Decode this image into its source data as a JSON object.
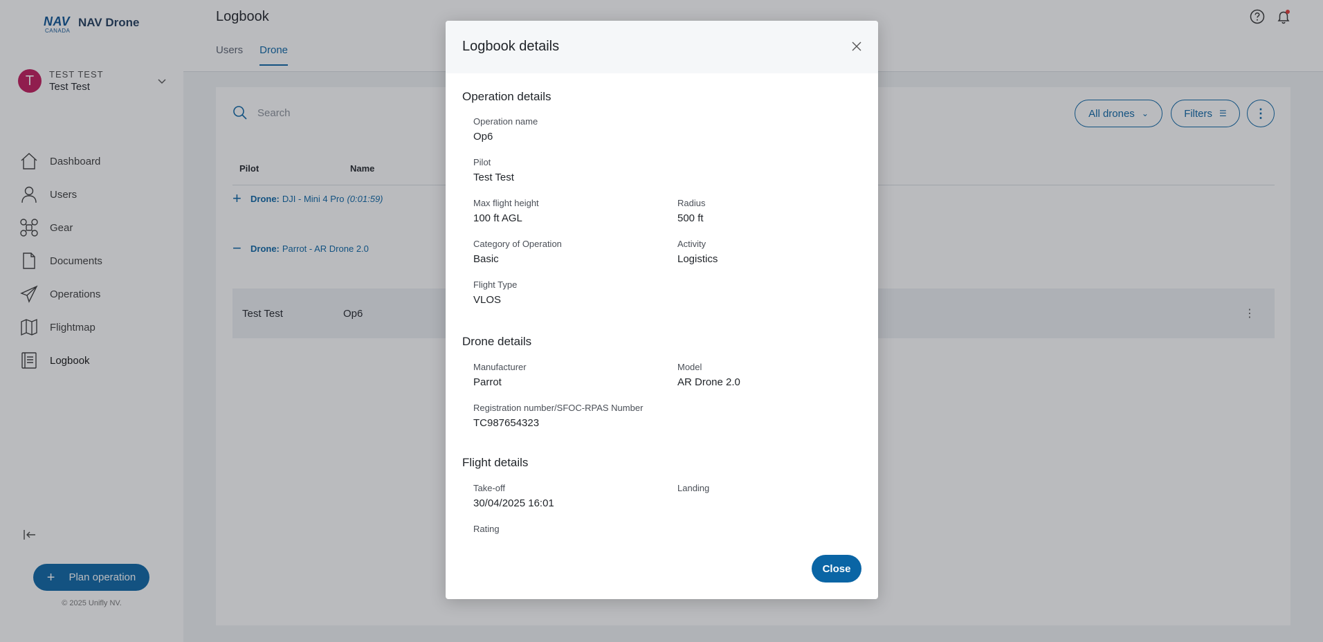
{
  "app": {
    "logo_mark": "NAV",
    "logo_sub": "CANADA",
    "name": "NAV Drone"
  },
  "user": {
    "initial": "T",
    "upper": "TEST TEST",
    "name": "Test Test"
  },
  "nav": {
    "items": [
      {
        "label": "Dashboard",
        "icon": "home-icon"
      },
      {
        "label": "Users",
        "icon": "user-icon"
      },
      {
        "label": "Gear",
        "icon": "drone-icon"
      },
      {
        "label": "Documents",
        "icon": "document-icon"
      },
      {
        "label": "Operations",
        "icon": "paper-plane-icon"
      },
      {
        "label": "Flightmap",
        "icon": "map-icon"
      },
      {
        "label": "Logbook",
        "icon": "logbook-icon"
      }
    ],
    "active": "Logbook"
  },
  "sidebar_footer": {
    "plan_label": "Plan operation",
    "copyright": "© 2025 Unifly NV."
  },
  "header": {
    "title": "Logbook",
    "tabs": [
      {
        "label": "Users",
        "active": false
      },
      {
        "label": "Drone",
        "active": true
      }
    ]
  },
  "toolbar": {
    "search_placeholder": "Search",
    "drones_label": "All drones",
    "filters_label": "Filters"
  },
  "table": {
    "columns": [
      "Pilot",
      "Name"
    ],
    "groups": [
      {
        "sign": "+",
        "prefix": "Drone:",
        "label": "DJI - Mini 4 Pro",
        "duration": "(0:01:59)"
      },
      {
        "sign": "−",
        "prefix": "Drone:",
        "label": "Parrot - AR Drone 2.0",
        "duration": ""
      }
    ],
    "rows": [
      {
        "pilot": "Test Test",
        "name": "Op6"
      }
    ]
  },
  "modal": {
    "title": "Logbook details",
    "operation": {
      "title": "Operation details",
      "operation_name_label": "Operation name",
      "operation_name": "Op6",
      "pilot_label": "Pilot",
      "pilot": "Test Test",
      "max_height_label": "Max flight height",
      "max_height": "100 ft AGL",
      "radius_label": "Radius",
      "radius": "500 ft",
      "category_label": "Category of Operation",
      "category": "Basic",
      "activity_label": "Activity",
      "activity": "Logistics",
      "flight_type_label": "Flight Type",
      "flight_type": "VLOS"
    },
    "drone": {
      "title": "Drone details",
      "manufacturer_label": "Manufacturer",
      "manufacturer": "Parrot",
      "model_label": "Model",
      "model": "AR Drone 2.0",
      "registration_label": "Registration number/SFOC-RPAS Number",
      "registration": "TC987654323"
    },
    "flight": {
      "title": "Flight details",
      "takeoff_label": "Take-off",
      "takeoff": "30/04/2025 16:01",
      "landing_label": "Landing",
      "rating_label": "Rating"
    },
    "close_label": "Close"
  },
  "colors": {
    "primary": "#0a65a5",
    "avatar": "#c2185b",
    "notification_dot": "#e53935"
  }
}
